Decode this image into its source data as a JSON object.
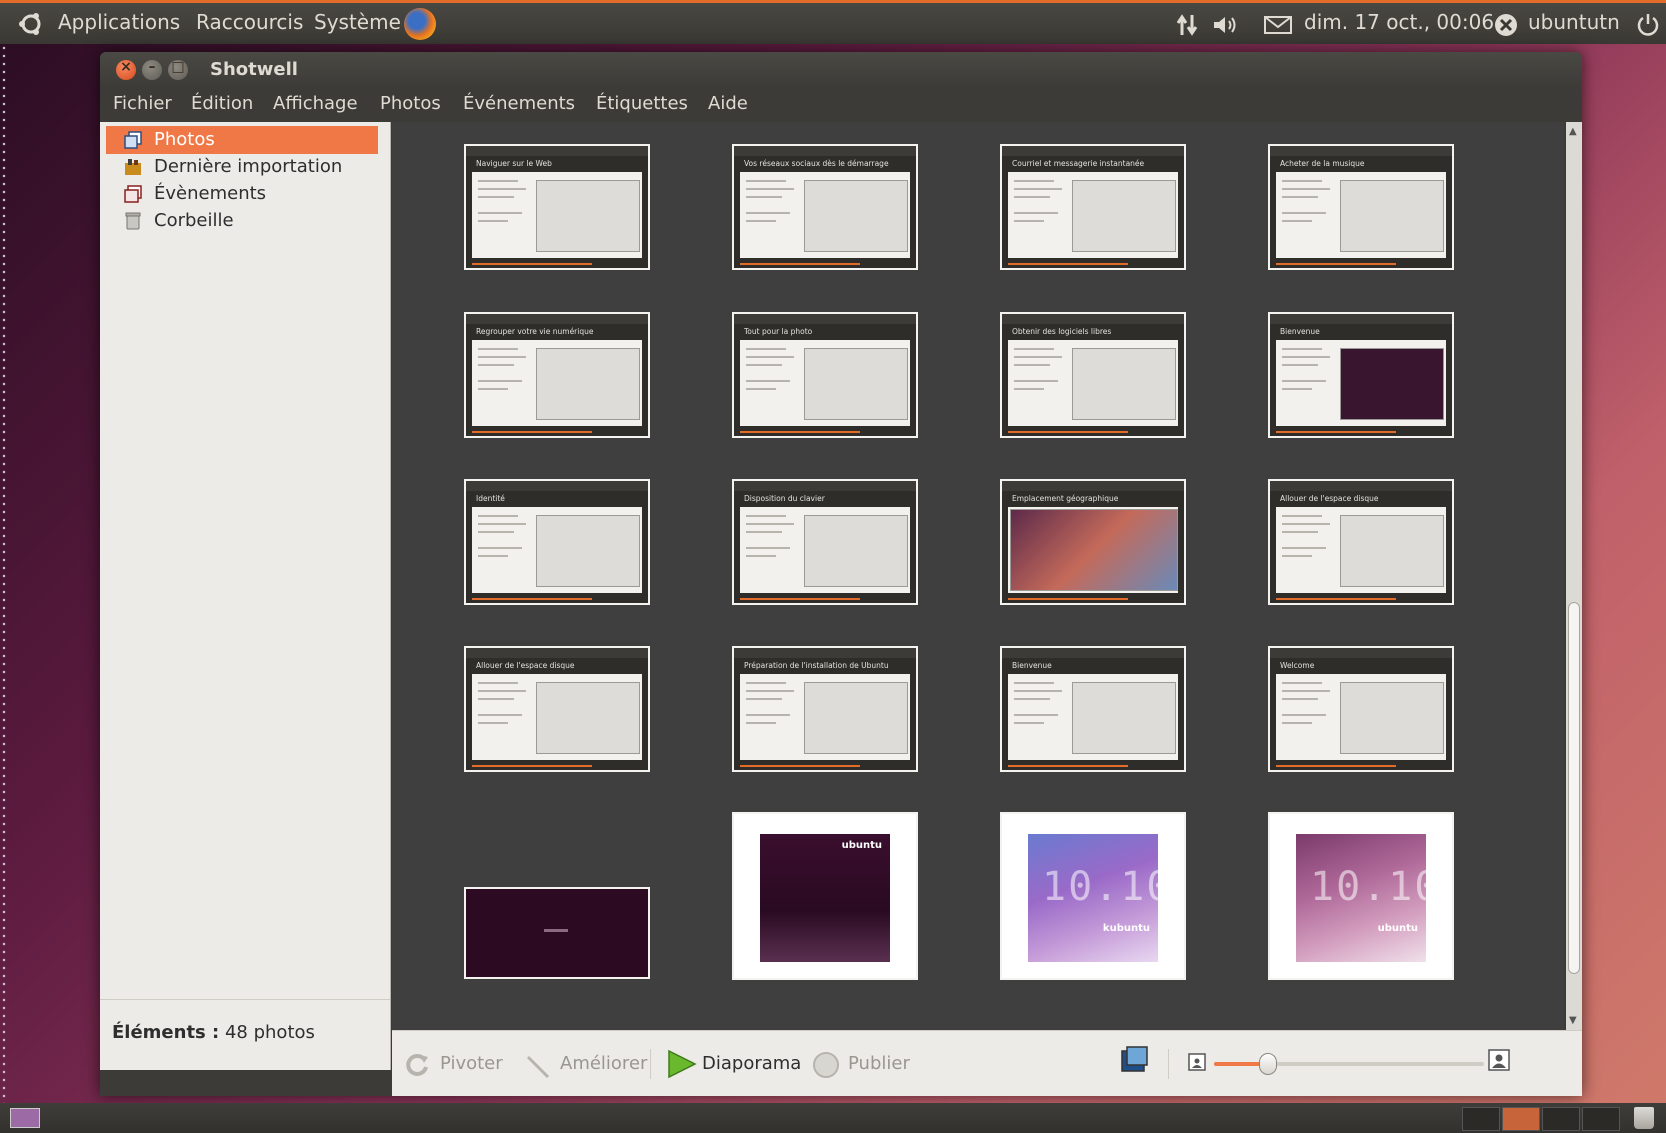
{
  "top_panel": {
    "menus": [
      "Applications",
      "Raccourcis",
      "Système"
    ],
    "datetime": "dim. 17 oct., 00:06",
    "user": "ubuntutn",
    "icons": [
      "ubuntu-logo-icon",
      "firefox-icon",
      "network-icon",
      "volume-icon",
      "mail-icon",
      "user-status-icon",
      "power-icon"
    ]
  },
  "window": {
    "title": "Shotwell",
    "menu": [
      "Fichier",
      "Édition",
      "Affichage",
      "Photos",
      "Événements",
      "Étiquettes",
      "Aide"
    ]
  },
  "sidebar": {
    "items": [
      {
        "label": "Photos",
        "icon": "photos-icon",
        "active": true
      },
      {
        "label": "Dernière importation",
        "icon": "import-icon",
        "active": false
      },
      {
        "label": "Évènements",
        "icon": "events-icon",
        "active": false
      },
      {
        "label": "Corbeille",
        "icon": "trash-icon",
        "active": false
      }
    ]
  },
  "status": {
    "label": "Éléments",
    "value": " 48 photos"
  },
  "photos": [
    {
      "caption": "Naviguer sur le Web"
    },
    {
      "caption": "Vos réseaux sociaux dès le démarrage"
    },
    {
      "caption": "Courriel et messagerie instantanée"
    },
    {
      "caption": "Acheter de la musique"
    },
    {
      "caption": "Regrouper votre vie numérique"
    },
    {
      "caption": "Tout pour la photo"
    },
    {
      "caption": "Obtenir des logiciels libres"
    },
    {
      "caption": "Bienvenue"
    },
    {
      "caption": "Identité"
    },
    {
      "caption": "Disposition du clavier"
    },
    {
      "caption": "Emplacement géographique"
    },
    {
      "caption": "Allouer de l'espace disque"
    },
    {
      "caption": "Allouer de l'espace disque"
    },
    {
      "caption": "Préparation de l'installation de Ubuntu"
    },
    {
      "caption": "Bienvenue"
    },
    {
      "caption": "Welcome"
    }
  ],
  "posters": [
    {
      "brand": "ubuntu"
    },
    {
      "brand": "kubuntu"
    },
    {
      "brand": "ubuntu"
    }
  ],
  "toolbar": {
    "rotate": "Pivoter",
    "enhance": "Améliorer",
    "slideshow": "Diaporama",
    "publish": "Publier",
    "zoom_level": 0.2
  },
  "colors": {
    "accent": "#f07746",
    "panel_border": "#e46c2b",
    "content_bg": "#3f3f3f"
  }
}
